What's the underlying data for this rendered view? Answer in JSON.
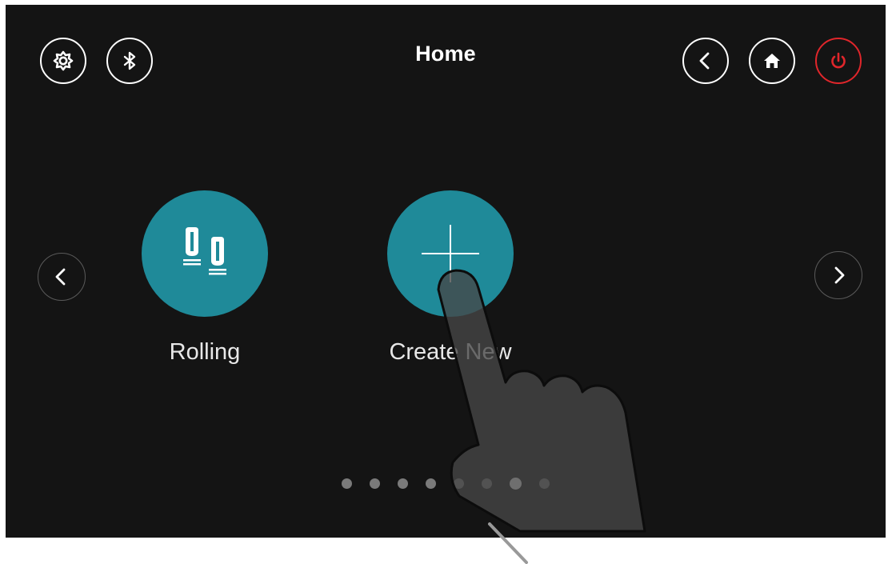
{
  "header": {
    "title": "Home",
    "left_buttons": [
      {
        "name": "settings",
        "icon": "gear-icon"
      },
      {
        "name": "bluetooth",
        "icon": "bluetooth-icon"
      }
    ],
    "right_buttons": [
      {
        "name": "back",
        "icon": "chevron-left-icon"
      },
      {
        "name": "home",
        "icon": "home-icon"
      },
      {
        "name": "power",
        "icon": "power-icon",
        "color": "#e0262b"
      }
    ]
  },
  "carousel": {
    "items": [
      {
        "label": "Rolling",
        "icon": "rolling-pins-icon"
      },
      {
        "label": "Create New",
        "icon": "plus-icon"
      }
    ],
    "prev_icon": "chevron-left-icon",
    "next_icon": "chevron-right-icon",
    "accent_color": "#1f8a99"
  },
  "pagination": {
    "total": 8,
    "active_index": 7
  },
  "overlay": {
    "icon": "pointing-hand-icon"
  }
}
